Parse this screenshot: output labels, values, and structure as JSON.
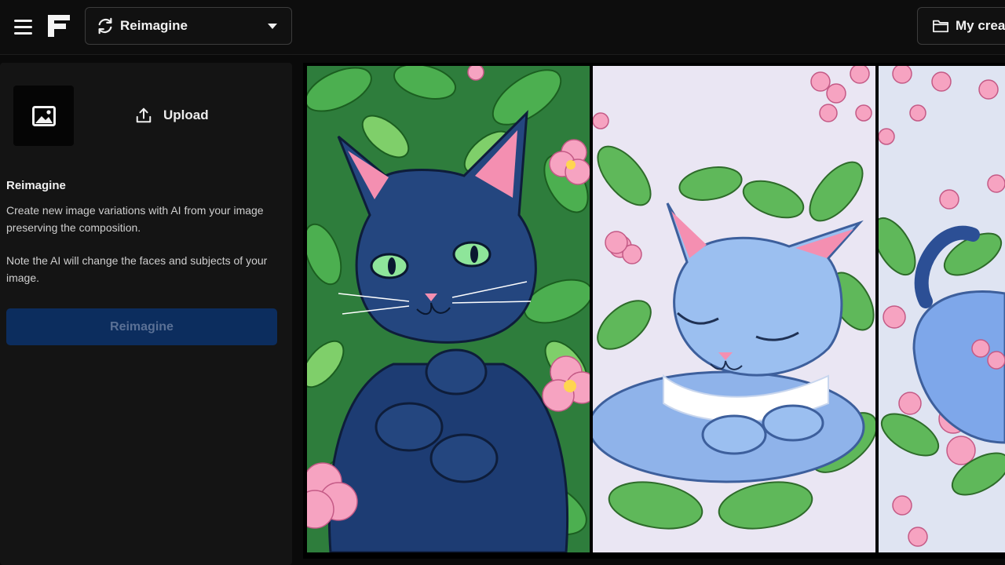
{
  "header": {
    "mode_label": "Reimagine",
    "creations_label": "My creat"
  },
  "sidebar": {
    "upload_label": "Upload",
    "title": "Reimagine",
    "description": "Create new image variations with AI from your image preserving the composition.",
    "note": "Note the AI will change the faces and subjects of your image.",
    "action_label": "Reimagine"
  },
  "icons": [
    "menu-icon",
    "logo",
    "refresh-icon",
    "chevron-down-icon",
    "folder-icon",
    "image-placeholder-icon",
    "upload-icon"
  ],
  "colors": {
    "background": "#0a0a0a",
    "panel": "#141414",
    "button_disabled": "#0c2d5e",
    "leaf_green": "#4caf50",
    "flower_pink": "#f6a3c1"
  }
}
